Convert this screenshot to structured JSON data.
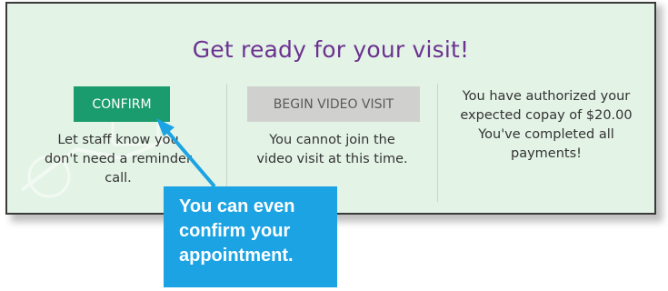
{
  "card": {
    "title": "Get ready for your visit!",
    "confirm": {
      "button_label": "CONFIRM",
      "description_lines": [
        "Let staff know you",
        "don't need a reminder",
        "call."
      ]
    },
    "video": {
      "button_label": "BEGIN VIDEO VISIT",
      "description_lines": [
        "You cannot join the",
        "video visit at this time."
      ]
    },
    "payment": {
      "lines": [
        "You have authorized your",
        "expected copay of $20.00",
        "You've completed all",
        "payments!"
      ]
    }
  },
  "callout": {
    "lines": [
      "You can even",
      "confirm your",
      "appointment."
    ]
  },
  "colors": {
    "title": "#6b3290",
    "confirm_button": "#1a9c6f",
    "video_button_disabled": "#d0d1cf",
    "callout": "#1ba3e3",
    "card_background": "#e3f3e6"
  },
  "icons": [
    "decorative-calendar-icon",
    "callout-arrow-icon"
  ]
}
